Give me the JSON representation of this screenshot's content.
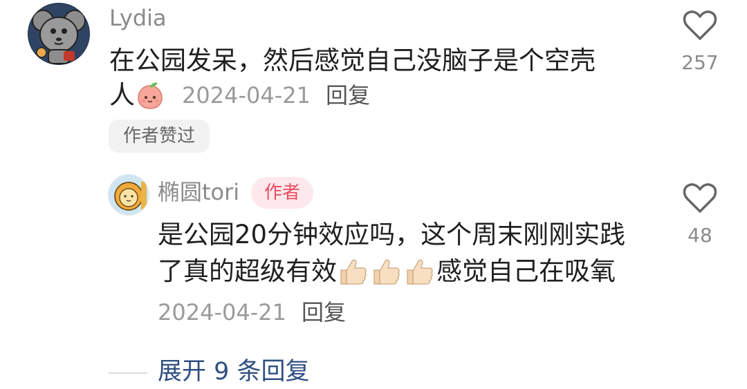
{
  "comment": {
    "username": "Lydia",
    "text_line1": "在公园发呆，然后感觉自己没脑子是个空壳",
    "text_line2": "人",
    "emoji": "peach-face-emoji",
    "date": "2024-04-21",
    "reply_label": "回复",
    "liked_badge": "作者赞过",
    "likes": "257"
  },
  "reply": {
    "username": "椭圆tori",
    "author_tag": "作者",
    "text_line1": "是公园20分钟效应吗，这个周末刚刚实践",
    "text_line2_a": "了真的超级有效",
    "text_line2_b": "感觉自己在吸氧",
    "emoji": "thumbs-up-emoji",
    "date": "2024-04-21",
    "reply_label": "回复",
    "likes": "48"
  },
  "expand": {
    "label": "展开 9 条回复"
  },
  "colors": {
    "author_tag_text": "#ea4d63",
    "author_tag_bg": "#fde9ec",
    "expand_link": "#2f4f82",
    "muted": "#8a8a8a"
  }
}
